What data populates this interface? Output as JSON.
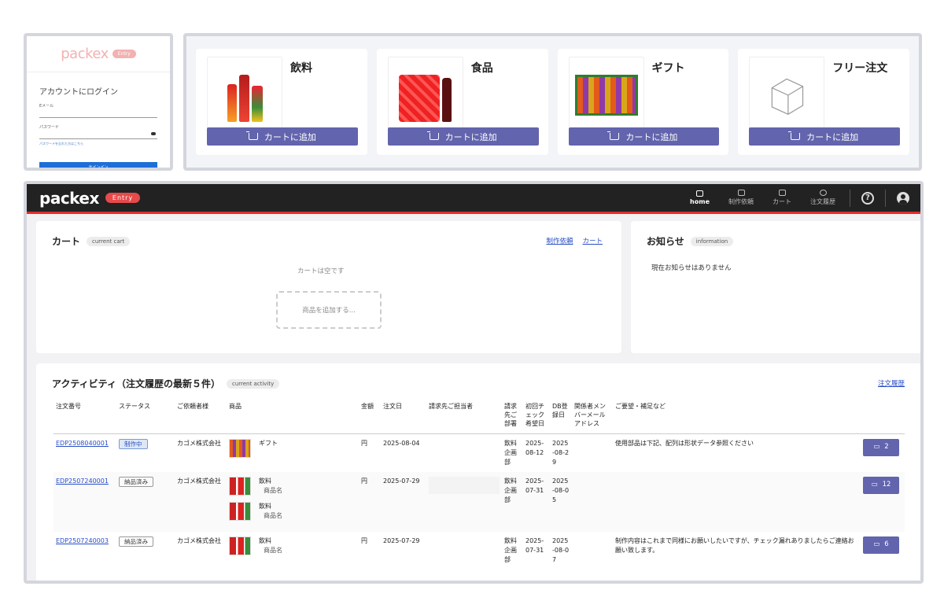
{
  "login": {
    "logo": "packex",
    "badge": "Entry",
    "title": "アカウントにログイン",
    "email_label": "Eメール",
    "password_label": "パスワード",
    "forgot": "パスワードを忘れた方はこちら",
    "signin": "サインイン"
  },
  "products": [
    {
      "title": "飲料",
      "button": "カートに追加"
    },
    {
      "title": "食品",
      "button": "カートに追加"
    },
    {
      "title": "ギフト",
      "button": "カートに追加"
    },
    {
      "title": "フリー注文",
      "button": "カートに追加"
    }
  ],
  "header": {
    "logo": "packex",
    "badge": "Entry",
    "nav": [
      "home",
      "制作依頼",
      "カート",
      "注文履歴"
    ]
  },
  "cart": {
    "title": "カート",
    "badge": "current cart",
    "link_request": "制作依頼",
    "link_cart": "カート",
    "empty": "カートは空です",
    "add": "商品を追加する..."
  },
  "news": {
    "title": "お知らせ",
    "badge": "information",
    "empty": "現在お知らせはありません"
  },
  "activity": {
    "title": "アクティビティ（注文履歴の最新５件）",
    "badge": "current activity",
    "history_link": "注文履歴",
    "columns": [
      "注文番号",
      "ステータス",
      "ご依頼者様",
      "商品",
      "金額",
      "注文日",
      "請求先ご担当者",
      "請求先ご部署",
      "初回チェック希望日",
      "DB登録日",
      "関係者メンバーメールアドレス",
      "ご要望・補足など"
    ],
    "rows": [
      {
        "id": "EDP2508040001",
        "status": "制作中",
        "client": "カゴメ株式会社",
        "items": [
          {
            "cat": "ギフト",
            "name": ""
          }
        ],
        "price": "円",
        "date": "2025-08-04",
        "dept": "飲料企画部",
        "check": "2025-08-12",
        "db": "2025-08-29",
        "note": "使用部品は下記、配列は形状データ参照ください",
        "count": "2"
      },
      {
        "id": "EDP2507240001",
        "status": "納品済み",
        "client": "カゴメ株式会社",
        "items": [
          {
            "cat": "飲料",
            "name": "商品名"
          },
          {
            "cat": "飲料",
            "name": "商品名"
          }
        ],
        "price": "円",
        "date": "2025-07-29",
        "dept": "飲料企画部",
        "check": "2025-07-31",
        "db": "2025-08-05",
        "note": "",
        "count": "12"
      },
      {
        "id": "EDP2507240003",
        "status": "納品済み",
        "client": "カゴメ株式会社",
        "items": [
          {
            "cat": "飲料",
            "name": "商品名"
          }
        ],
        "price": "円",
        "date": "2025-07-29",
        "dept": "飲料企画部",
        "check": "2025-07-31",
        "db": "2025-08-07",
        "note": "制作内容はこれまで同様にお願いしたいですが、チェック漏れありましたらご連絡お願い致します。",
        "count": "6"
      }
    ]
  }
}
